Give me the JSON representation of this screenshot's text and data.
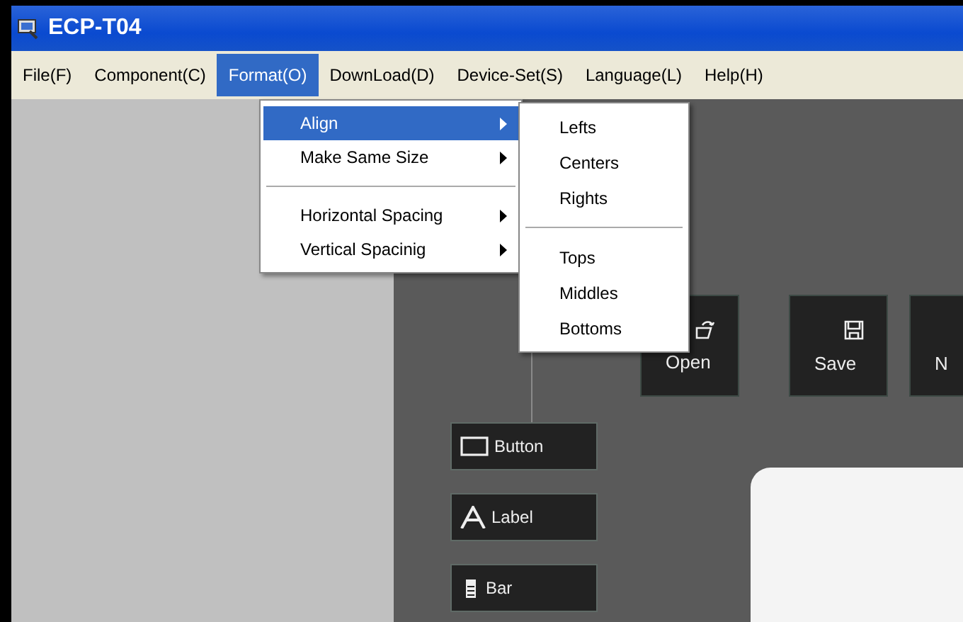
{
  "window": {
    "title": "ECP-T04"
  },
  "menubar": [
    {
      "label": "File(F)",
      "selected": false
    },
    {
      "label": "Component(C)",
      "selected": false
    },
    {
      "label": "Format(O)",
      "selected": true
    },
    {
      "label": "DownLoad(D)",
      "selected": false
    },
    {
      "label": "Device-Set(S)",
      "selected": false
    },
    {
      "label": "Language(L)",
      "selected": false
    },
    {
      "label": "Help(H)",
      "selected": false
    }
  ],
  "format_menu": [
    {
      "kind": "item",
      "label": "Align",
      "selected": true
    },
    {
      "kind": "item",
      "label": "Make Same Size",
      "selected": false
    },
    {
      "kind": "separator"
    },
    {
      "kind": "item",
      "label": "Horizontal Spacing",
      "selected": false
    },
    {
      "kind": "item",
      "label": "Vertical Spacinig",
      "selected": false
    }
  ],
  "align_submenu": [
    {
      "kind": "item",
      "label": "Lefts"
    },
    {
      "kind": "item",
      "label": "Centers"
    },
    {
      "kind": "item",
      "label": "Rights"
    },
    {
      "kind": "separator"
    },
    {
      "kind": "item",
      "label": "Tops"
    },
    {
      "kind": "item",
      "label": "Middles"
    },
    {
      "kind": "item",
      "label": "Bottoms"
    }
  ],
  "toolbar": [
    {
      "kind": "open",
      "label": "Open"
    },
    {
      "kind": "save",
      "label": "Save"
    },
    {
      "kind": "new",
      "label": "N"
    }
  ],
  "components": [
    {
      "kind": "button",
      "label": "Button"
    },
    {
      "kind": "label",
      "label": "Label"
    },
    {
      "kind": "bar",
      "label": "Bar"
    }
  ]
}
